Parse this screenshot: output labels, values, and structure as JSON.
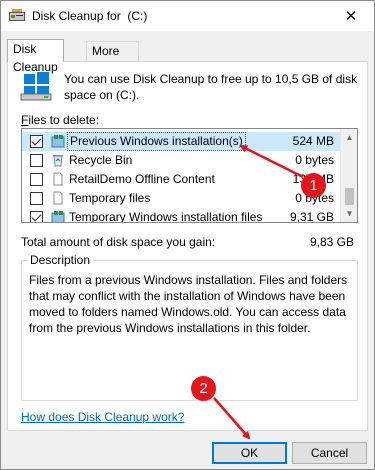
{
  "window": {
    "title": "Disk Cleanup for  (C:)",
    "close_glyph": "✕"
  },
  "tabs": [
    {
      "label": "Disk Cleanup",
      "active": true
    },
    {
      "label": "More Options",
      "active": false
    }
  ],
  "intro": "You can use Disk Cleanup to free up to 10,5 GB of disk space on  (C:).",
  "files_label_prefix": "F",
  "files_label_rest": "iles to delete:",
  "files": [
    {
      "name": "Previous Windows installation(s)",
      "size": "524 MB",
      "checked": true,
      "selected": true,
      "icon": "windows-installation-icon"
    },
    {
      "name": "Recycle Bin",
      "size": "0 bytes",
      "checked": false,
      "selected": false,
      "icon": "recycle-bin-icon"
    },
    {
      "name": "RetailDemo Offline Content",
      "size": "137 MB",
      "checked": false,
      "selected": false,
      "icon": "blank-page-icon"
    },
    {
      "name": "Temporary files",
      "size": "0 bytes",
      "checked": false,
      "selected": false,
      "icon": "blank-page-icon"
    },
    {
      "name": "Temporary Windows installation files",
      "size": "9,31 GB",
      "checked": true,
      "selected": false,
      "icon": "windows-installation-icon"
    }
  ],
  "total_label": "Total amount of disk space you gain:",
  "total_value": "9,83 GB",
  "description_legend": "Description",
  "description": "Files from a previous Windows installation.  Files and folders that may conflict with the installation of Windows have been moved to folders named Windows.old.  You can access data from the previous Windows installations in this folder.",
  "help_link": "How does Disk Cleanup work?",
  "buttons": {
    "ok": "OK",
    "cancel": "Cancel"
  },
  "annotations": [
    {
      "number": "1",
      "color": "#e4151b"
    },
    {
      "number": "2",
      "color": "#e4151b"
    }
  ]
}
